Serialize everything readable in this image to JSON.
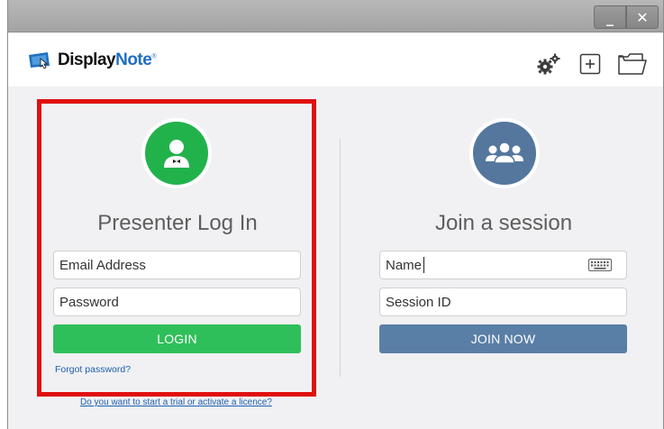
{
  "window": {
    "minimize_label": "_",
    "close_label": "✕"
  },
  "app": {
    "logo_part1": "Display",
    "logo_part2": "Note",
    "logo_mark": "®"
  },
  "toolbar": {
    "icons": [
      "gears-icon",
      "add-page-icon",
      "folder-icon"
    ]
  },
  "presenter": {
    "title": "Presenter Log In",
    "email_placeholder": "Email Address",
    "password_placeholder": "Password",
    "login_label": "LOGIN",
    "forgot_label": "Forgot password?"
  },
  "session": {
    "title": "Join a session",
    "name_placeholder": "Name",
    "session_id_placeholder": "Session ID",
    "join_label": "JOIN NOW"
  },
  "footer": {
    "trial_link": "Do you want to start a trial or activate a licence?"
  },
  "colors": {
    "login_green": "#2fbf5a",
    "join_blue": "#5a7fa6",
    "highlight_red": "#e01010",
    "link_blue": "#1f5fb0"
  }
}
